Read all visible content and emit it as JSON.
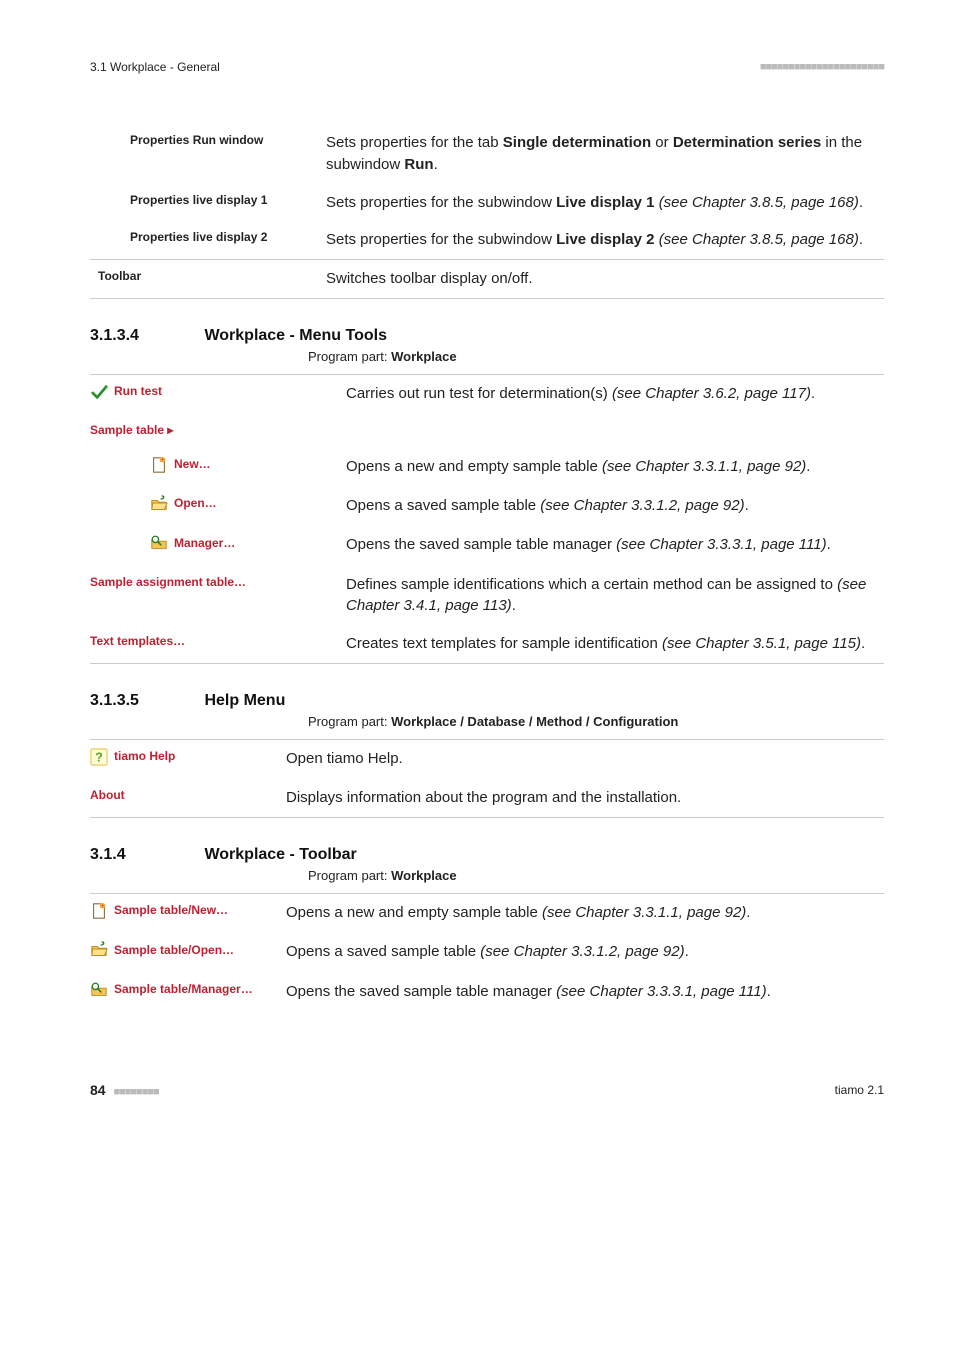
{
  "header": {
    "left": "3.1 Workplace - General",
    "dashes": "■■■■■■■■■■■■■■■■■■■■■■"
  },
  "footer": {
    "page": "84",
    "dashes": "■■■■■■■■",
    "right": "tiamo 2.1"
  },
  "topTable": {
    "rows": [
      {
        "label": "Properties Run window",
        "desc_parts": [
          "Sets properties for the tab ",
          {
            "b": "Single determination"
          },
          " or ",
          {
            "b": "Determination series"
          },
          " in the subwindow ",
          {
            "b": "Run"
          },
          "."
        ]
      },
      {
        "label": "Properties live display 1",
        "desc_parts": [
          "Sets properties for the subwindow ",
          {
            "b": "Live display 1"
          },
          " ",
          {
            "i": "(see Chapter 3.8.5, page 168)"
          },
          "."
        ]
      },
      {
        "label": "Properties live display 2",
        "desc_parts": [
          "Sets properties for the subwindow ",
          {
            "b": "Live display 2"
          },
          " ",
          {
            "i": "(see Chapter 3.8.5, page 168)"
          },
          "."
        ]
      }
    ],
    "footerRow": {
      "label": "Toolbar",
      "desc": "Switches toolbar display on/off."
    }
  },
  "sec4": {
    "num": "3.1.3.4",
    "title": "Workplace - Menu Tools",
    "progpart_prefix": "Program part: ",
    "progpart_bold": "Workplace",
    "rows": [
      {
        "icon": "check",
        "label": "Run test",
        "desc_parts": [
          "Carries out run test for determination(s) ",
          {
            "i": "(see Chapter 3.6.2, page 117)"
          },
          "."
        ],
        "indent": 0
      },
      {
        "icon": null,
        "label": "Sample table ▸",
        "desc_parts": [],
        "indent": 0
      },
      {
        "icon": "new",
        "label": "New…",
        "desc_parts": [
          "Opens a new and empty sample table ",
          {
            "i": "(see Chapter 3.3.1.1, page 92)"
          },
          "."
        ],
        "indent": 1
      },
      {
        "icon": "open",
        "label": "Open…",
        "desc_parts": [
          "Opens a saved sample table ",
          {
            "i": "(see Chapter 3.3.1.2, page 92)"
          },
          "."
        ],
        "indent": 1
      },
      {
        "icon": "manager",
        "label": "Manager…",
        "desc_parts": [
          "Opens the saved sample table manager ",
          {
            "i": "(see Chapter 3.3.3.1, page 111)"
          },
          "."
        ],
        "indent": 1
      },
      {
        "icon": null,
        "label": "Sample assignment table…",
        "desc_parts": [
          "Defines sample identifications which a certain method can be assigned to ",
          {
            "i": "(see Chapter 3.4.1, page 113)"
          },
          "."
        ],
        "indent": 0
      },
      {
        "icon": null,
        "label": "Text templates…",
        "desc_parts": [
          "Creates text templates for sample identification ",
          {
            "i": "(see Chapter 3.5.1, page 115)"
          },
          "."
        ],
        "indent": 0
      }
    ]
  },
  "sec5": {
    "num": "3.1.3.5",
    "title": "Help Menu",
    "progpart_prefix": "Program part: ",
    "progpart_bold": "Workplace / Database / Method / Configuration",
    "rows": [
      {
        "icon": "help",
        "label": "tiamo Help",
        "desc": "Open tiamo Help."
      },
      {
        "icon": null,
        "label": "About",
        "desc": "Displays information about the program and the installation."
      }
    ]
  },
  "sec6": {
    "num": "3.1.4",
    "title": "Workplace - Toolbar",
    "progpart_prefix": "Program part: ",
    "progpart_bold": "Workplace",
    "rows": [
      {
        "icon": "new",
        "label": "Sample table/New…",
        "desc_parts": [
          "Opens a new and empty sample table ",
          {
            "i": "(see Chapter 3.3.1.1, page 92)"
          },
          "."
        ]
      },
      {
        "icon": "open",
        "label": "Sample table/Open…",
        "desc_parts": [
          "Opens a saved sample table ",
          {
            "i": "(see Chapter 3.3.1.2, page 92)"
          },
          "."
        ]
      },
      {
        "icon": "manager",
        "label": "Sample table/Manager…",
        "desc_parts": [
          "",
          "Opens the saved sample table manager ",
          {
            "i": "(see Chapter 3.3.3.1, page 111)"
          },
          "."
        ]
      }
    ]
  }
}
